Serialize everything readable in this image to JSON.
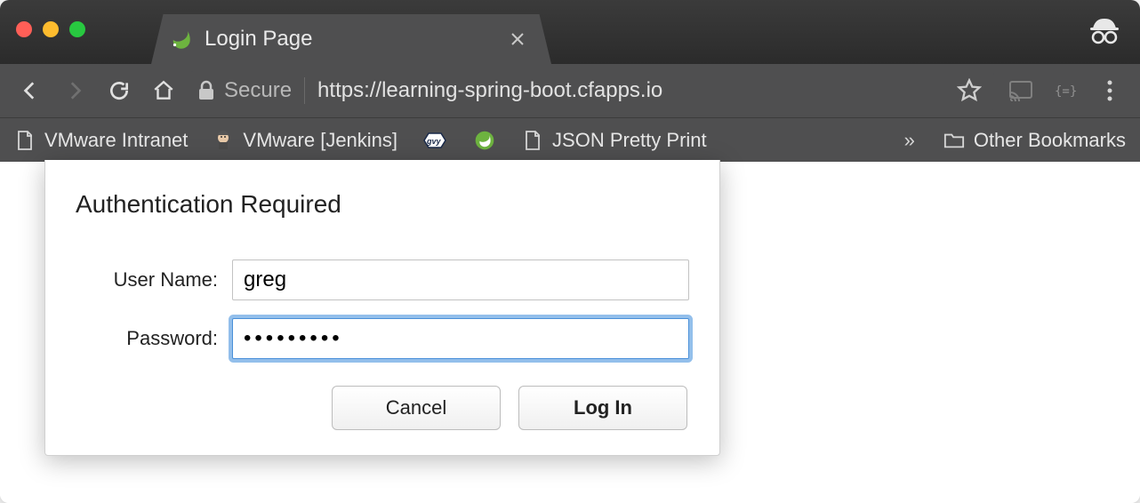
{
  "window": {
    "tab_title": "Login Page",
    "incognito": true
  },
  "toolbar": {
    "secure_label": "Secure",
    "url": "https://learning-spring-boot.cfapps.io"
  },
  "bookmarks": {
    "items": [
      {
        "label": "VMware Intranet",
        "icon": "page"
      },
      {
        "label": "VMware [Jenkins]",
        "icon": "jenkins"
      },
      {
        "label": "",
        "icon": "groovy"
      },
      {
        "label": "",
        "icon": "spring"
      },
      {
        "label": "JSON Pretty Print",
        "icon": "page"
      }
    ],
    "other_label": "Other Bookmarks"
  },
  "auth": {
    "title": "Authentication Required",
    "username_label": "User Name:",
    "username_value": "greg",
    "password_label": "Password:",
    "password_value": "•••••••••",
    "cancel_label": "Cancel",
    "login_label": "Log In"
  }
}
